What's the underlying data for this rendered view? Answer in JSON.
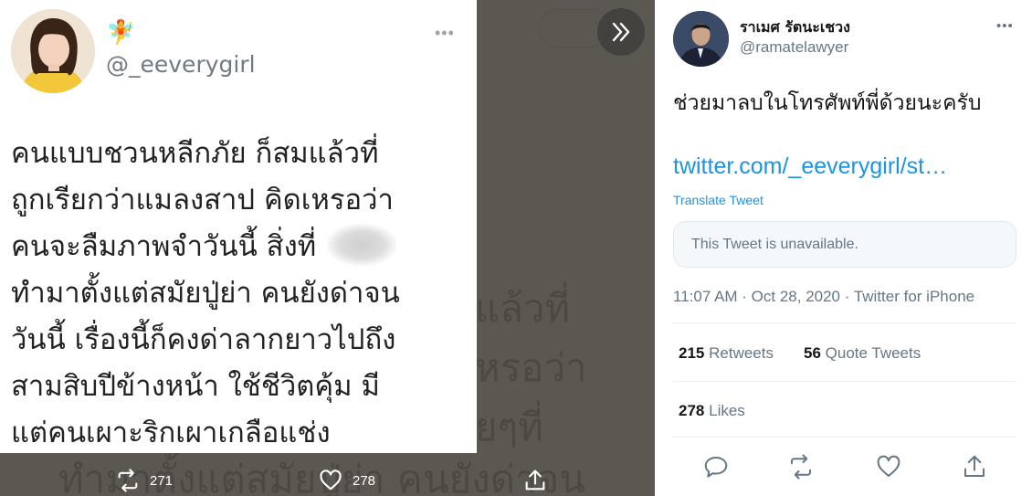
{
  "left": {
    "card": {
      "handle": "@_eeverygirl",
      "emoji": "🧚",
      "lines": [
        "คนแบบชวนหลีกภัย ก็สมแล้วที่",
        "ถูกเรียกว่าแมลงสาป คิดเหรอว่า",
        "คนจะลืมภาพจำวันนี้ สิ่งที่",
        "ทำมาตั้งแต่สมัยปู่ย่า คนยังด่าจน",
        "วันนี้ เรื่องนี้ก็คงด่าลากยาวไปถึง",
        "สามสิบปีข้างหน้า ใช้ชีวิตคุ้ม มี",
        "แต่คนเผาะริกเผาเกลือแช่ง"
      ]
    },
    "actions": {
      "retweets": "271",
      "likes": "278"
    }
  },
  "tweet": {
    "name": "ราเมศ รัตนะเชวง",
    "handle": "@ramatelawyer",
    "text": "ช่วยมาลบในโทรศัพท์พี่ด้วยนะครับ",
    "link": "twitter.com/_eeverygirl/st…",
    "translate": "Translate Tweet",
    "quote_unavailable": "This Tweet is unavailable.",
    "meta": "11:07 AM · Oct 28, 2020 · Twitter for iPhone",
    "retweets_count": "215",
    "retweets_label": "Retweets",
    "quote_count": "56",
    "quote_label": "Quote Tweets",
    "likes_count": "278",
    "likes_label": "Likes"
  },
  "colors": {
    "accent": "#1b95e0",
    "overlay": "#5b5851"
  },
  "icons": [
    "reply-icon",
    "retweet-icon",
    "like-icon",
    "share-icon",
    "chevron-double-right-icon"
  ]
}
